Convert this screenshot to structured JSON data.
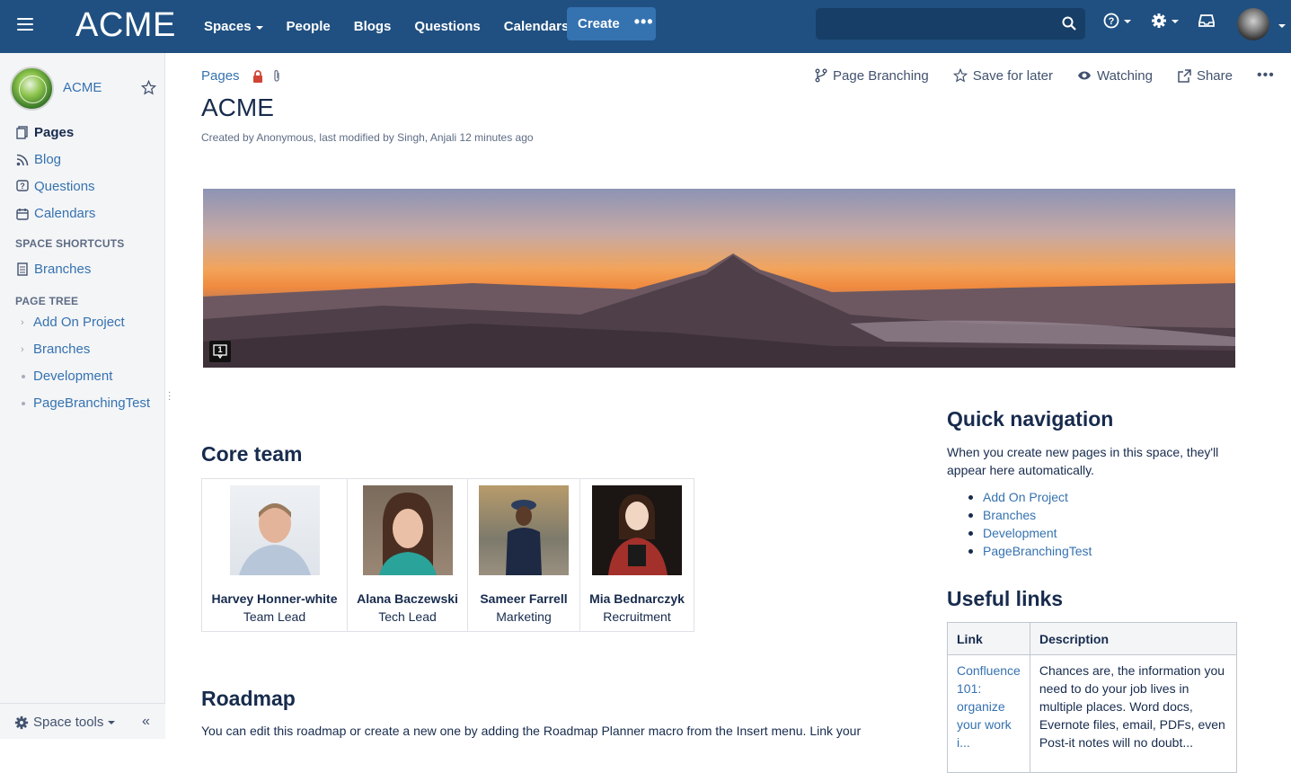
{
  "nav": {
    "logo": "ACME",
    "items": [
      {
        "label": "Spaces",
        "dropdown": true
      },
      {
        "label": "People",
        "dropdown": false
      },
      {
        "label": "Blogs",
        "dropdown": false
      },
      {
        "label": "Questions",
        "dropdown": false
      },
      {
        "label": "Calendars",
        "dropdown": false
      }
    ],
    "create_label": "Create",
    "create_more": "•••",
    "search_placeholder": ""
  },
  "sidebar": {
    "space_name": "ACME",
    "items": [
      {
        "label": "Pages",
        "icon": "pages-icon",
        "active": true
      },
      {
        "label": "Blog",
        "icon": "rss-icon",
        "active": false
      },
      {
        "label": "Questions",
        "icon": "question-icon",
        "active": false
      },
      {
        "label": "Calendars",
        "icon": "calendar-icon",
        "active": false
      }
    ],
    "shortcuts_heading": "SPACE SHORTCUTS",
    "shortcuts": [
      {
        "label": "Branches",
        "icon": "page-icon"
      }
    ],
    "tree_heading": "PAGE TREE",
    "tree": [
      {
        "label": "Add On Project",
        "has_children": true
      },
      {
        "label": "Branches",
        "has_children": true
      },
      {
        "label": "Development",
        "has_children": false
      },
      {
        "label": "PageBranchingTest",
        "has_children": false
      }
    ],
    "space_tools": "Space tools"
  },
  "page": {
    "breadcrumb": "Pages",
    "actions": {
      "branching": "Page Branching",
      "save": "Save for later",
      "watching": "Watching",
      "share": "Share"
    },
    "title": "ACME",
    "meta": "Created by Anonymous, last modified by Singh, Anjali 12 minutes ago",
    "comment_count": "1",
    "core_team_heading": "Core team",
    "team": [
      {
        "name": "Harvey Honner-white",
        "role": "Team Lead"
      },
      {
        "name": "Alana Baczewski",
        "role": "Tech Lead"
      },
      {
        "name": "Sameer Farrell",
        "role": "Marketing"
      },
      {
        "name": "Mia Bednarczyk",
        "role": "Recruitment"
      }
    ],
    "roadmap_heading": "Roadmap",
    "roadmap_text": "You can edit this roadmap or create a new one by adding the Roadmap Planner macro from the Insert menu. Link your",
    "quick_nav_heading": "Quick navigation",
    "quick_nav_text": "When you create new pages in this space, they'll appear here automatically.",
    "quick_nav_links": [
      "Add On Project",
      "Branches",
      "Development",
      "PageBranchingTest"
    ],
    "useful_links_heading": "Useful links",
    "links_table": {
      "col_link": "Link",
      "col_desc": "Description",
      "row_link": "Confluence 101: organize your work i...",
      "row_desc": "Chances are, the information you need to do your job lives in multiple places. Word docs, Evernote files, email, PDFs, even Post-it notes will no doubt..."
    }
  }
}
